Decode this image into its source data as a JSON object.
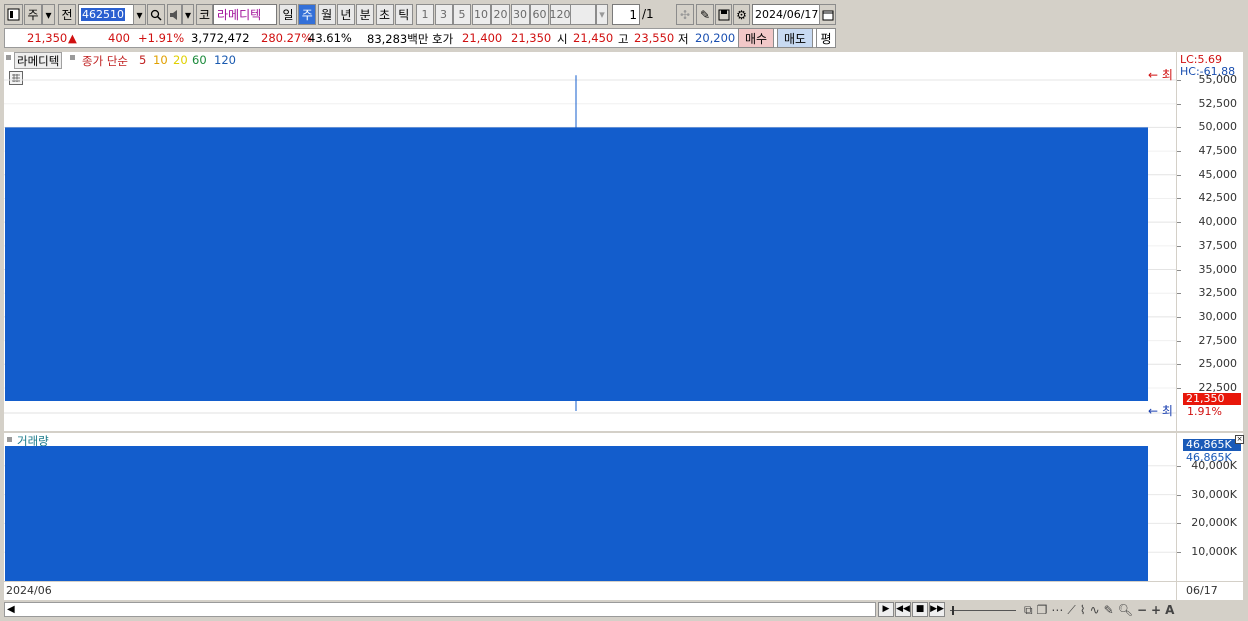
{
  "toolbar": {
    "market": "주",
    "prev": "전",
    "code": "462510",
    "name_prefix": "코",
    "name": "라메디텍",
    "periods": [
      "일",
      "주",
      "월",
      "년",
      "분",
      "초",
      "틱"
    ],
    "active_period": "주",
    "intervals": [
      "1",
      "3",
      "5",
      "10",
      "20",
      "30",
      "60",
      "120"
    ],
    "page_value": "1",
    "page_total": "/1",
    "date": "2024/06/17"
  },
  "quote": {
    "price": "21,350",
    "change_arrow": "▲",
    "change": "400",
    "change_pct": "+1.91%",
    "volume": "3,772,472",
    "volume_ratio": "280.27%",
    "turnover": "43.61%",
    "amount": "83,283백만",
    "bid_label": "호가",
    "bid": "21,400",
    "ask": "21,350",
    "open_label": "시",
    "open": "21,450",
    "high_label": "고",
    "high": "23,550",
    "low_label": "저",
    "low": "20,200",
    "buy_label": "매수",
    "sell_label": "매도",
    "avg_label": "평"
  },
  "price_chart": {
    "stock_name": "라메디텍",
    "ma_label": "종가 단순",
    "ma_periods": [
      "5",
      "10",
      "20",
      "60",
      "120"
    ],
    "ma_colors": [
      "#c02020",
      "#e0a000",
      "#e0d000",
      "#1a8a3a",
      "#1a5ab0"
    ],
    "lc_label": "LC:5.69",
    "hc_label": "HC:-61.88",
    "max_marker": "최",
    "min_marker": "최",
    "current_price": "21,350",
    "current_pct": "1.91%",
    "bar_color": "#135dcc"
  },
  "volume_chart": {
    "title": "거래량",
    "current_value": "46,865K",
    "current_value2": "46,865K",
    "bar_color": "#135dcc"
  },
  "chart_data": [
    {
      "type": "bar",
      "title": "",
      "x": [
        "2024/06/17"
      ],
      "ohlc": {
        "open": 50000,
        "high": 55500,
        "low": 20200,
        "close": 21350
      },
      "ylim": [
        20000,
        55000
      ],
      "yticks": [
        "55,000",
        "52,500",
        "50,000",
        "47,500",
        "45,000",
        "42,500",
        "40,000",
        "37,500",
        "35,000",
        "32,500",
        "30,000",
        "27,500",
        "25,000",
        "22,500"
      ],
      "legend": "top-left"
    },
    {
      "type": "bar",
      "title": "",
      "x": [
        "2024/06/17"
      ],
      "values": [
        46865
      ],
      "ylim": [
        0,
        46865
      ],
      "yticks": [
        "40,000K",
        "30,000K",
        "20,000K",
        "10,000K"
      ]
    }
  ],
  "xaxis": {
    "left_label": "2024/06",
    "right_label": "06/17"
  }
}
